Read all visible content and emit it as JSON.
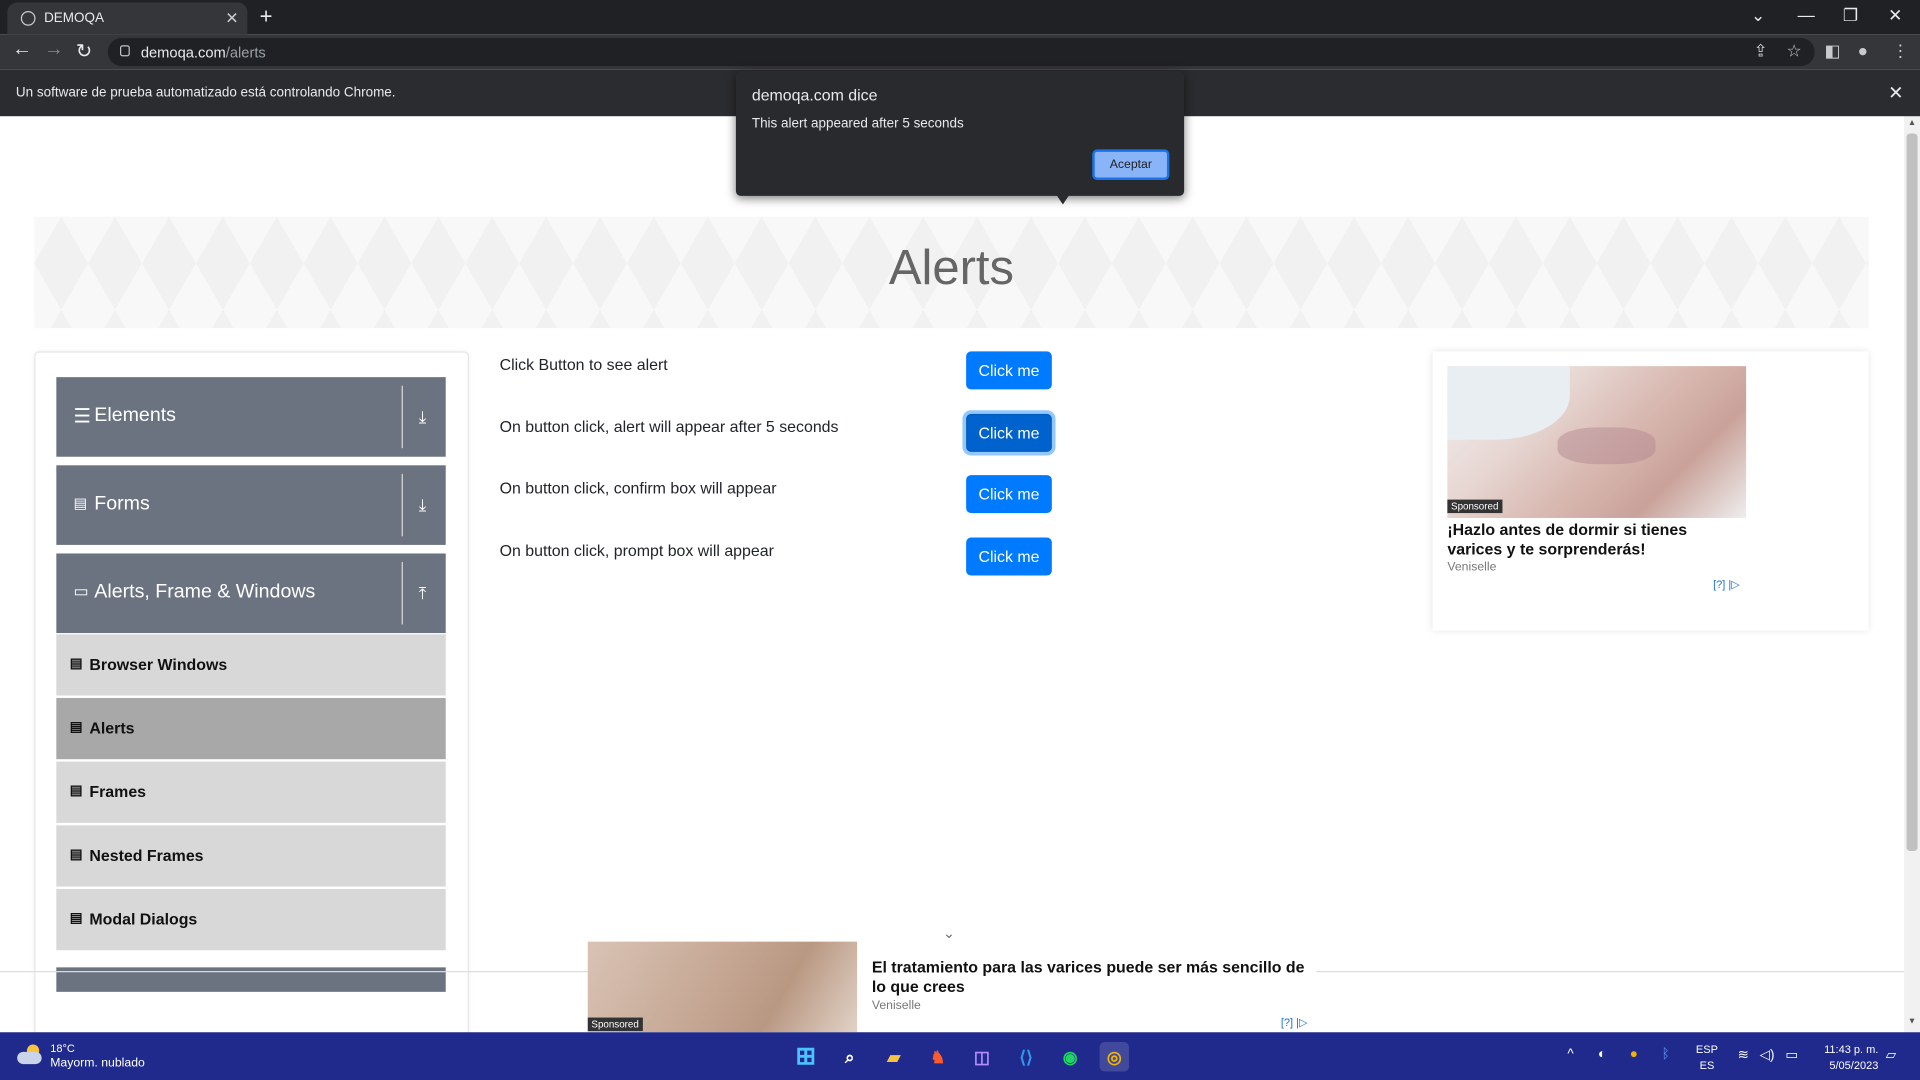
{
  "browser": {
    "tab_title": "DEMOQA",
    "tab_close": "✕",
    "new_tab": "+",
    "url_host": "demoqa.com",
    "url_path": "/alerts",
    "infobar_text": "Un software de prueba automatizado está controlando Chrome.",
    "infobar_close": "✕"
  },
  "page": {
    "title": "Alerts",
    "sidebar": {
      "groups": [
        {
          "label": "Elements",
          "icon": "hamburger-icon"
        },
        {
          "label": "Forms",
          "icon": "document-icon"
        },
        {
          "label": "Alerts, Frame & Windows",
          "icon": "window-icon"
        }
      ],
      "items": [
        {
          "label": "Browser Windows",
          "active": false
        },
        {
          "label": "Alerts",
          "active": true
        },
        {
          "label": "Frames",
          "active": false
        },
        {
          "label": "Nested Frames",
          "active": false
        },
        {
          "label": "Modal Dialogs",
          "active": false
        }
      ]
    },
    "rows": [
      {
        "label": "Click Button to see alert",
        "button": "Click me"
      },
      {
        "label": "On button click, alert will appear after 5 seconds",
        "button": "Click me"
      },
      {
        "label": "On button click, confirm box will appear",
        "button": "Click me"
      },
      {
        "label": "On button click, prompt box will appear",
        "button": "Click me"
      }
    ],
    "right_ad": {
      "sponsored": "Sponsored",
      "headline": "¡Hazlo antes de dormir si tienes varices y te sorprenderás!",
      "brand": "Veniselle",
      "adchoice": "[?] |▷"
    },
    "bottom_ad": {
      "sponsored": "Sponsored",
      "headline": "El tratamiento para las varices puede ser más sencillo de lo que crees",
      "brand": "Veniselle",
      "adchoice": "[?] |▷"
    }
  },
  "dialog": {
    "title": "demoqa.com dice",
    "message": "This alert appeared after 5 seconds",
    "ok_button": "Aceptar"
  },
  "taskbar": {
    "temperature": "18°C",
    "condition": "Mayorm. nublado",
    "lang_1": "ESP",
    "lang_2": "ES",
    "time": "11:43 p. m.",
    "date": "5/05/2023"
  },
  "colors": {
    "primary_button": "#007bff",
    "sidebar_group": "#6b7280",
    "sidebar_item": "#d8d8d8",
    "taskbar": "#202a8c",
    "dialog_bg": "#292a2d",
    "dialog_button": "#8ab4f8"
  }
}
